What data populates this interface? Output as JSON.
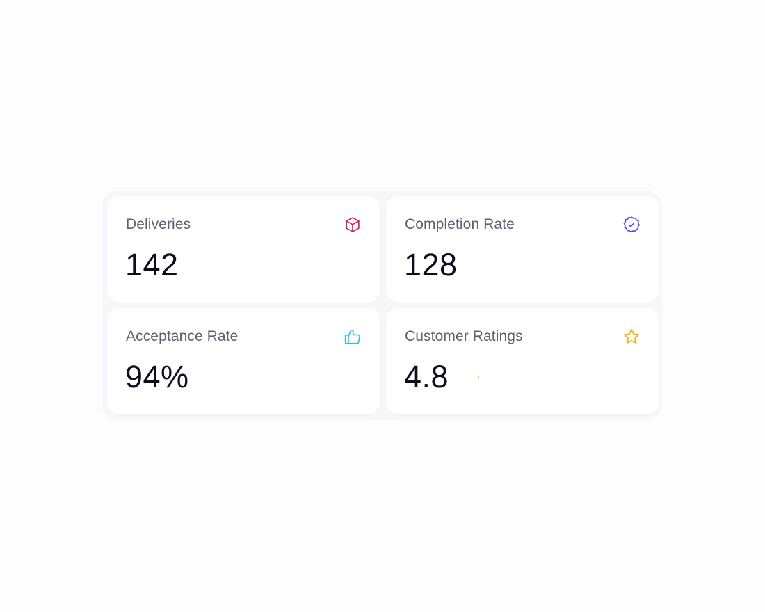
{
  "stats": {
    "deliveries": {
      "label": "Deliveries",
      "value": "142",
      "icon": "box-icon",
      "icon_color": "#d81b60"
    },
    "completion_rate": {
      "label": "Completion Rate",
      "value": "128",
      "icon": "verified-badge-icon",
      "icon_color": "#4f46e5"
    },
    "acceptance_rate": {
      "label": "Acceptance Rate",
      "value": "94%",
      "icon": "thumbs-up-icon",
      "icon_color": "#22c3d6"
    },
    "customer_ratings": {
      "label": "Customer Ratings",
      "value": "4.8",
      "icon": "star-icon",
      "icon_color": "#f2b10c"
    }
  },
  "colors": {
    "page_background": "#fdfdfe",
    "panel_background": "#f6f6fb",
    "card_background": "#ffffff",
    "label_text": "#5f5f73",
    "value_text": "#0d0d1f"
  }
}
